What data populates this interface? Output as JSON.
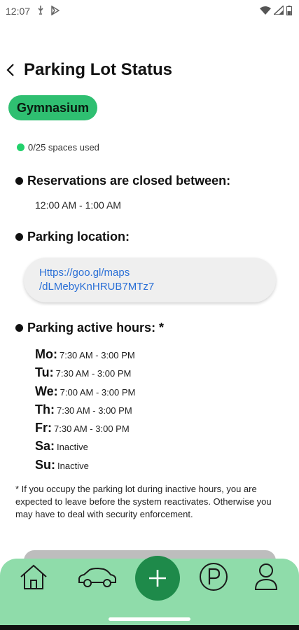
{
  "status_bar": {
    "time": "12:07"
  },
  "header": {
    "title": "Parking Lot Status"
  },
  "lot": {
    "name": "Gymnasium"
  },
  "usage": {
    "text": "0/25 spaces used",
    "status_color": "#22d16b"
  },
  "reservations": {
    "heading": "Reservations are closed between:",
    "time_range": "12:00 AM - 1:00 AM"
  },
  "location": {
    "heading": "Parking location:",
    "link_line1": "Https://goo.gl/maps",
    "link_line2": "/dLMebyKnHRUB7MTz7"
  },
  "hours": {
    "heading": "Parking active hours: *",
    "rows": [
      {
        "day": "Mo:",
        "time": "7:30 AM - 3:00 PM"
      },
      {
        "day": "Tu:",
        "time": "7:30 AM - 3:00 PM"
      },
      {
        "day": "We:",
        "time": "7:00 AM - 3:00 PM"
      },
      {
        "day": "Th:",
        "time": "7:30 AM - 3:00 PM"
      },
      {
        "day": "Fr:",
        "time": "7:30 AM - 3:00 PM"
      },
      {
        "day": "Sa:",
        "time": "Inactive"
      },
      {
        "day": "Su:",
        "time": "Inactive"
      }
    ]
  },
  "footnote": "* If you occupy the parking lot during inactive hours, you are expected to leave before the system reactivates. Otherwise you may have to deal with security enforcement.",
  "nav": {
    "items": [
      "home-icon",
      "car-icon",
      "plus-icon",
      "parking-icon",
      "profile-icon"
    ],
    "parking_letter": "P"
  },
  "colors": {
    "chip": "#2fbf71",
    "nav_bar": "#8fdcaa",
    "add_button": "#1e8a4a",
    "link": "#2a6fd6"
  }
}
